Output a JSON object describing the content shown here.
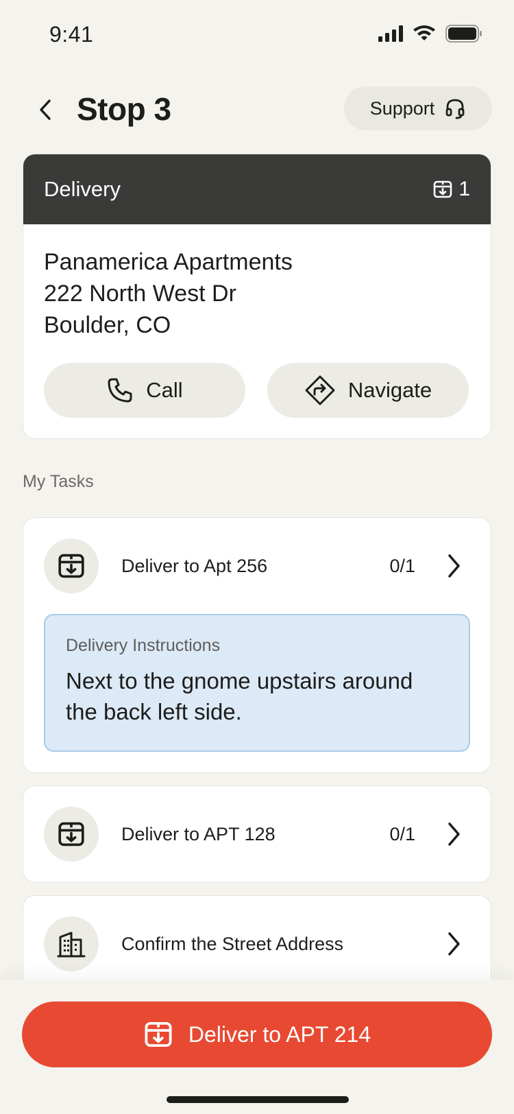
{
  "status": {
    "time": "9:41"
  },
  "header": {
    "title": "Stop 3",
    "support_label": "Support"
  },
  "stop": {
    "type_label": "Delivery",
    "package_count": "1",
    "address_line1": "Panamerica Apartments",
    "address_line2": "222 North West Dr",
    "address_line3": "Boulder, CO",
    "call_label": "Call",
    "navigate_label": "Navigate"
  },
  "tasks_section": {
    "label": "My Tasks"
  },
  "tasks": [
    {
      "label": "Deliver to Apt 256",
      "count": "0/1",
      "icon": "package-download-icon"
    },
    {
      "label": "Deliver to APT 128",
      "count": "0/1",
      "icon": "package-download-icon"
    },
    {
      "label": "Confirm the Street Address",
      "count": "",
      "icon": "building-icon"
    }
  ],
  "instructions": {
    "label": "Delivery Instructions",
    "text": "Next to the gnome upstairs around the back left side."
  },
  "cta": {
    "label": "Deliver to APT 214"
  },
  "colors": {
    "accent": "#e84932",
    "card_header": "#3a3a39",
    "background": "#f4f3ee",
    "instructions_bg": "#dce9f6"
  }
}
